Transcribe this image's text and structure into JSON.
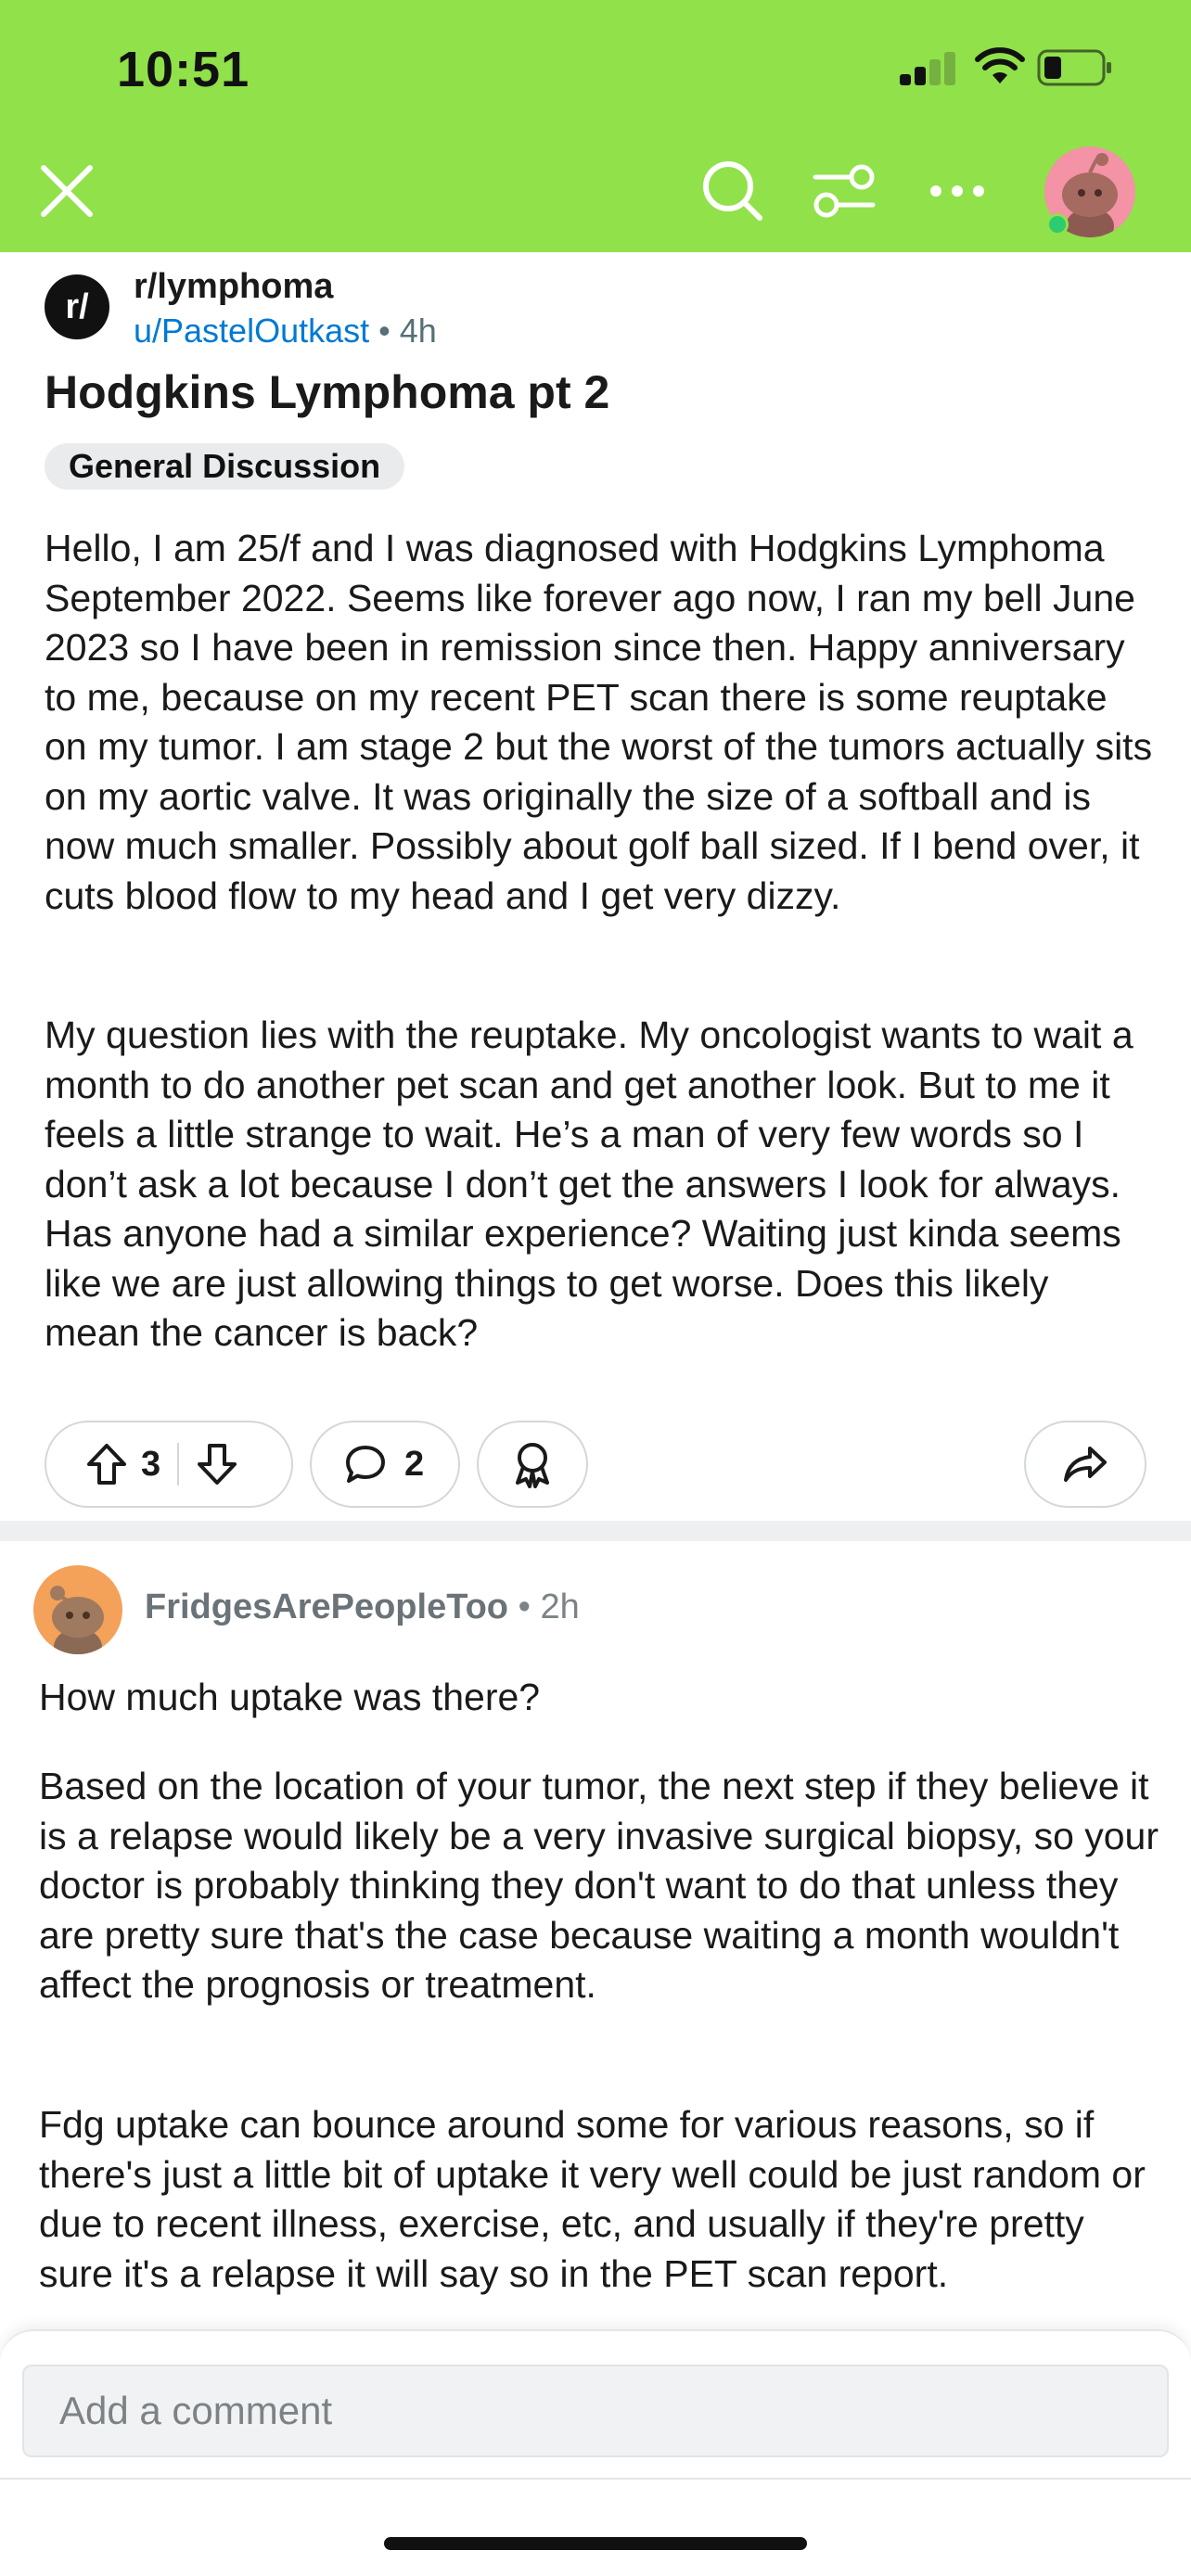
{
  "status_bar": {
    "time": "10:51"
  },
  "header": {
    "close_icon": "close-icon",
    "search_icon": "search-icon",
    "filter_icon": "sort-filter-icon",
    "more_icon": "more-horizontal-icon",
    "accent_color": "#90e14a"
  },
  "post": {
    "subreddit": "r/lymphoma",
    "subreddit_icon_text": "r/",
    "author": "u/PastelOutkast",
    "separator": "•",
    "age": "4h",
    "title": "Hodgkins Lymphoma pt 2",
    "flair": "General Discussion",
    "body": [
      "Hello, I am 25/f and I was diagnosed with Hodgkins Lymphoma September 2022. Seems like forever ago now, I ran my bell June 2023 so I have been in remission since then. Happy anniversary to me, because on my recent PET scan there is some reuptake on my tumor. I am stage 2 but the worst of the tumors actually sits on my aortic valve. It was originally the size of a softball and is now much smaller. Possibly about golf ball sized. If I bend over, it cuts blood flow to my head and I get very dizzy.",
      "My question lies with the reuptake. My oncologist wants to wait a month to do another pet scan and get another look. But to me it feels a little strange to wait. He’s a man of very few words so I don’t ask a lot because I don’t get the answers I look for always. Has anyone had a similar experience? Waiting just kinda seems like we are just allowing things to get worse. Does this likely mean the cancer is back?"
    ],
    "actions": {
      "upvotes": "3",
      "comments": "2"
    }
  },
  "comment": {
    "author": "FridgesArePeopleToo",
    "separator": "•",
    "age": "2h",
    "paragraphs": [
      "How much uptake was there?",
      "Based on the location of your tumor, the next step if they believe it is a relapse would likely be a very invasive surgical biopsy, so your doctor is probably thinking they don't want to do that unless they are pretty sure that's the case because waiting a month wouldn't affect the prognosis or treatment.",
      "Fdg uptake can bounce around some for various reasons, so if there's just a little bit of uptake it very well could be just random or due to recent illness, exercise, etc, and usually if they're pretty sure it's a relapse it will say so in the PET scan report."
    ]
  },
  "composer": {
    "placeholder": "Add a comment"
  }
}
